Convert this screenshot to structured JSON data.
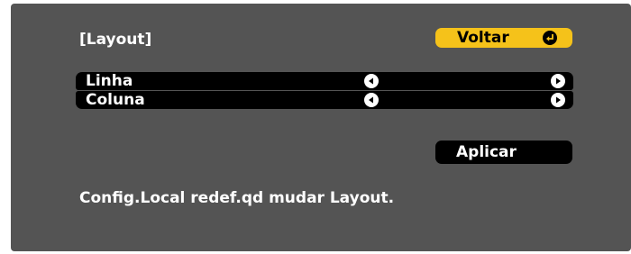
{
  "title": "[Layout]",
  "back_button": {
    "label": "Voltar",
    "icon": "enter-icon"
  },
  "rows": [
    {
      "label": "Linha",
      "left_icon": "arrow-left-icon",
      "right_icon": "arrow-right-icon"
    },
    {
      "label": "Coluna",
      "left_icon": "arrow-left-icon",
      "right_icon": "arrow-right-icon"
    }
  ],
  "apply_button": {
    "label": "Aplicar"
  },
  "hint": "Config.Local redef.qd mudar Layout.",
  "colors": {
    "panel": "#545454",
    "accent": "#f5c21a",
    "bar": "#000000",
    "text": "#ffffff"
  }
}
